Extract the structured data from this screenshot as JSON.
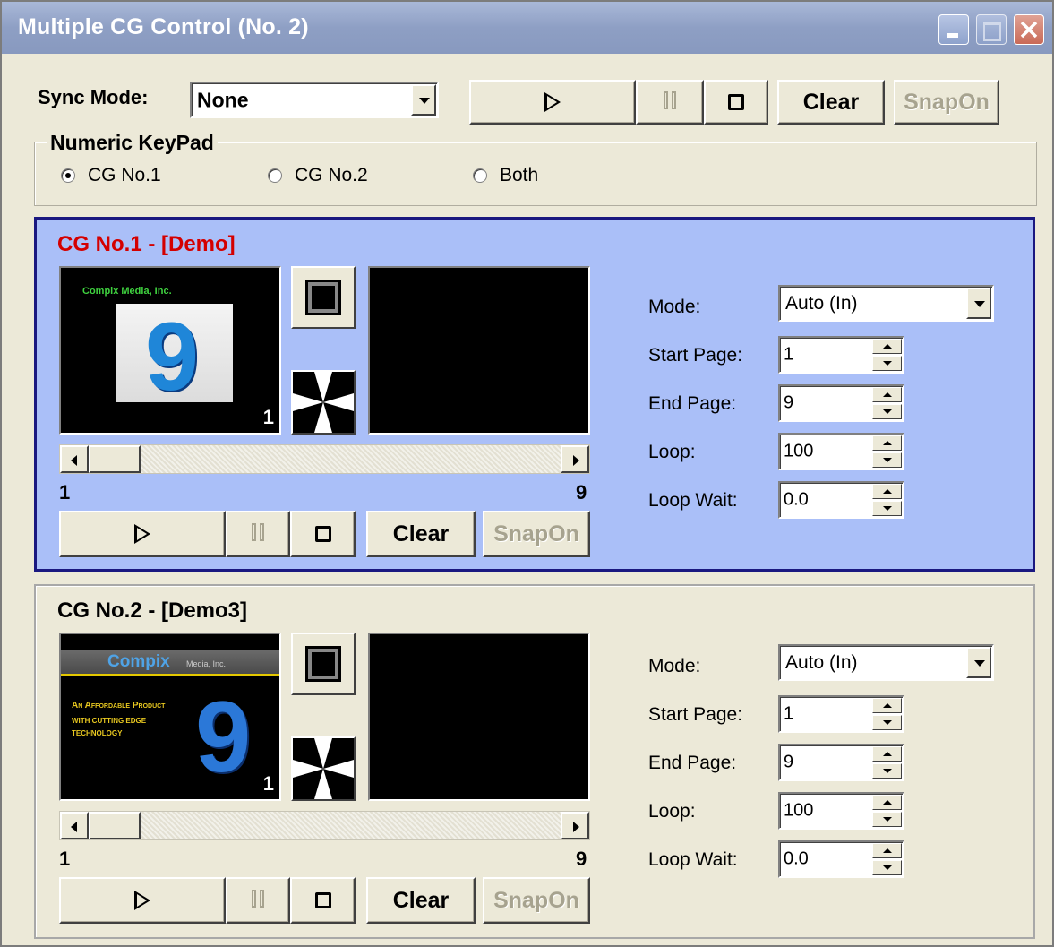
{
  "window": {
    "title": "Multiple CG Control (No. 2)"
  },
  "toolbar": {
    "sync_mode_label": "Sync Mode:",
    "sync_mode_value": "None",
    "clear_label": "Clear",
    "snapon_label": "SnapOn"
  },
  "keypad": {
    "title": "Numeric KeyPad",
    "options": [
      "CG No.1",
      "CG No.2",
      "Both"
    ],
    "selected": "CG No.1"
  },
  "cg1": {
    "title": "CG No.1 - [Demo]",
    "thumb": {
      "brand": "Compix Media, Inc.",
      "digit": "9",
      "page": "1"
    },
    "scroll_min": "1",
    "scroll_max": "9",
    "clear_label": "Clear",
    "snapon_label": "SnapOn",
    "mode_label": "Mode:",
    "mode_value": "Auto (In)",
    "start_page_label": "Start Page:",
    "start_page_value": "1",
    "end_page_label": "End Page:",
    "end_page_value": "9",
    "loop_label": "Loop:",
    "loop_value": "100",
    "loop_wait_label": "Loop Wait:",
    "loop_wait_value": "0.0"
  },
  "cg2": {
    "title": "CG No.2 - [Demo3]",
    "thumb": {
      "brand": "Compix",
      "brand_small": "Media, Inc.",
      "line1": "An Affordable Product",
      "line2": "with cutting edge",
      "line3": "technology",
      "digit": "9",
      "page": "1"
    },
    "scroll_min": "1",
    "scroll_max": "9",
    "clear_label": "Clear",
    "snapon_label": "SnapOn",
    "mode_label": "Mode:",
    "mode_value": "Auto (In)",
    "start_page_label": "Start Page:",
    "start_page_value": "1",
    "end_page_label": "End Page:",
    "end_page_value": "9",
    "loop_label": "Loop:",
    "loop_value": "100",
    "loop_wait_label": "Loop Wait:",
    "loop_wait_value": "0.0"
  },
  "colors": {
    "active_panel_bg": "#aabff8",
    "active_panel_border": "#1a1880",
    "active_title": "#d40000",
    "window_bg": "#ece9d8"
  },
  "icons": [
    "minimize-icon",
    "maximize-icon",
    "close-icon",
    "play-icon",
    "pause-icon",
    "stop-icon",
    "chevron-down-icon",
    "spin-up-icon",
    "spin-down-icon",
    "scroll-left-icon",
    "scroll-right-icon",
    "cue-square-icon",
    "wipe-transition-icon"
  ]
}
